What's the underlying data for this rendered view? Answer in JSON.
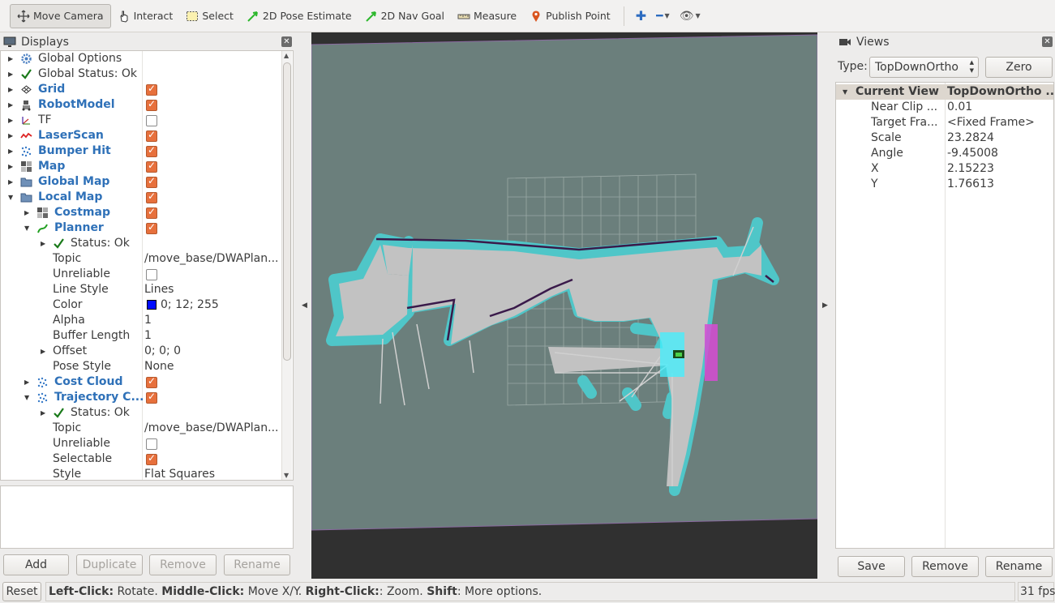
{
  "toolbar": {
    "tools": [
      "Move Camera",
      "Interact",
      "Select",
      "2D Pose Estimate",
      "2D Nav Goal",
      "Measure",
      "Publish Point"
    ]
  },
  "displays": {
    "title": "Displays",
    "rows": [
      {
        "label": "Global Options"
      },
      {
        "label": "Global Status: Ok"
      },
      {
        "label": "Grid"
      },
      {
        "label": "RobotModel"
      },
      {
        "label": "TF"
      },
      {
        "label": "LaserScan"
      },
      {
        "label": "Bumper Hit"
      },
      {
        "label": "Map"
      },
      {
        "label": "Global Map"
      },
      {
        "label": "Local Map"
      },
      {
        "label": "Costmap"
      },
      {
        "label": "Planner"
      },
      {
        "label": "Status: Ok"
      },
      {
        "label": "Topic",
        "value": "/move_base/DWAPlan..."
      },
      {
        "label": "Unreliable"
      },
      {
        "label": "Line Style",
        "value": "Lines"
      },
      {
        "label": "Color",
        "value": "0; 12; 255"
      },
      {
        "label": "Alpha",
        "value": "1"
      },
      {
        "label": "Buffer Length",
        "value": "1"
      },
      {
        "label": "Offset",
        "value": "0; 0; 0"
      },
      {
        "label": "Pose Style",
        "value": "None"
      },
      {
        "label": "Cost Cloud"
      },
      {
        "label": "Trajectory C..."
      },
      {
        "label": "Status: Ok"
      },
      {
        "label": "Topic",
        "value": "/move_base/DWAPlan..."
      },
      {
        "label": "Unreliable"
      },
      {
        "label": "Selectable"
      },
      {
        "label": "Style",
        "value": "Flat Squares"
      }
    ],
    "buttons": {
      "add": "Add",
      "duplicate": "Duplicate",
      "remove": "Remove",
      "rename": "Rename"
    }
  },
  "views": {
    "title": "Views",
    "type_label": "Type:",
    "type_value": "TopDownOrtho",
    "zero": "Zero",
    "header": {
      "name": "Current View",
      "value": "TopDownOrtho ..."
    },
    "props": [
      {
        "name": "Near Clip ...",
        "value": "0.01"
      },
      {
        "name": "Target Fra...",
        "value": "<Fixed Frame>"
      },
      {
        "name": "Scale",
        "value": "23.2824"
      },
      {
        "name": "Angle",
        "value": "-9.45008"
      },
      {
        "name": "X",
        "value": "2.15223"
      },
      {
        "name": "Y",
        "value": "1.76613"
      }
    ],
    "buttons": {
      "save": "Save",
      "remove": "Remove",
      "rename": "Rename"
    }
  },
  "status": {
    "reset": "Reset",
    "parts": [
      {
        "b": "Left-Click:",
        "t": " Rotate. "
      },
      {
        "b": "Middle-Click:",
        "t": " Move X/Y. "
      },
      {
        "b": "Right-Click:",
        "t": ": Zoom. "
      },
      {
        "b": "Shift",
        "t": ": More options."
      }
    ],
    "fps": "31 fps"
  },
  "colors": {
    "accent": "#2f71b8",
    "checkbox": "#e7703c",
    "map_bg": "#6b7f7c",
    "planner_color": "#000cff"
  }
}
